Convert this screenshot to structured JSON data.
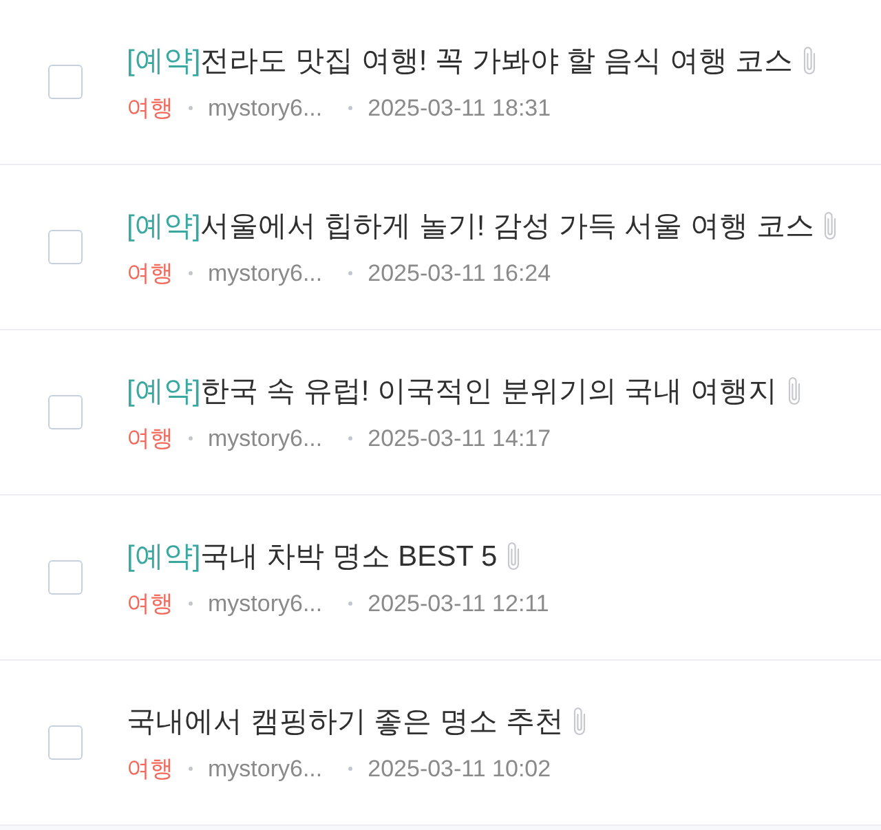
{
  "posts": [
    {
      "checked": false,
      "tag": "[예약]",
      "title": "전라도 맛집 여행! 꼭 가봐야 할 음식 여행 코스",
      "attachment": true,
      "category": "여행",
      "author": "mystory6...",
      "date": "2025-03-11 18:31"
    },
    {
      "checked": false,
      "tag": "[예약]",
      "title": "서울에서 힙하게 놀기! 감성 가득 서울 여행 코스",
      "attachment": true,
      "category": "여행",
      "author": "mystory6...",
      "date": "2025-03-11 16:24"
    },
    {
      "checked": false,
      "tag": "[예약]",
      "title": "한국 속 유럽! 이국적인 분위기의 국내 여행지",
      "attachment": true,
      "category": "여행",
      "author": "mystory6...",
      "date": "2025-03-11 14:17"
    },
    {
      "checked": false,
      "tag": "[예약]",
      "title": "국내 차박 명소 BEST 5",
      "attachment": true,
      "category": "여행",
      "author": "mystory6...",
      "date": "2025-03-11 12:11"
    },
    {
      "checked": false,
      "title": "국내에서 캠핑하기 좋은 명소 추천",
      "attachment": true,
      "category": "여행",
      "author": "mystory6...",
      "date": "2025-03-11 10:02"
    }
  ]
}
